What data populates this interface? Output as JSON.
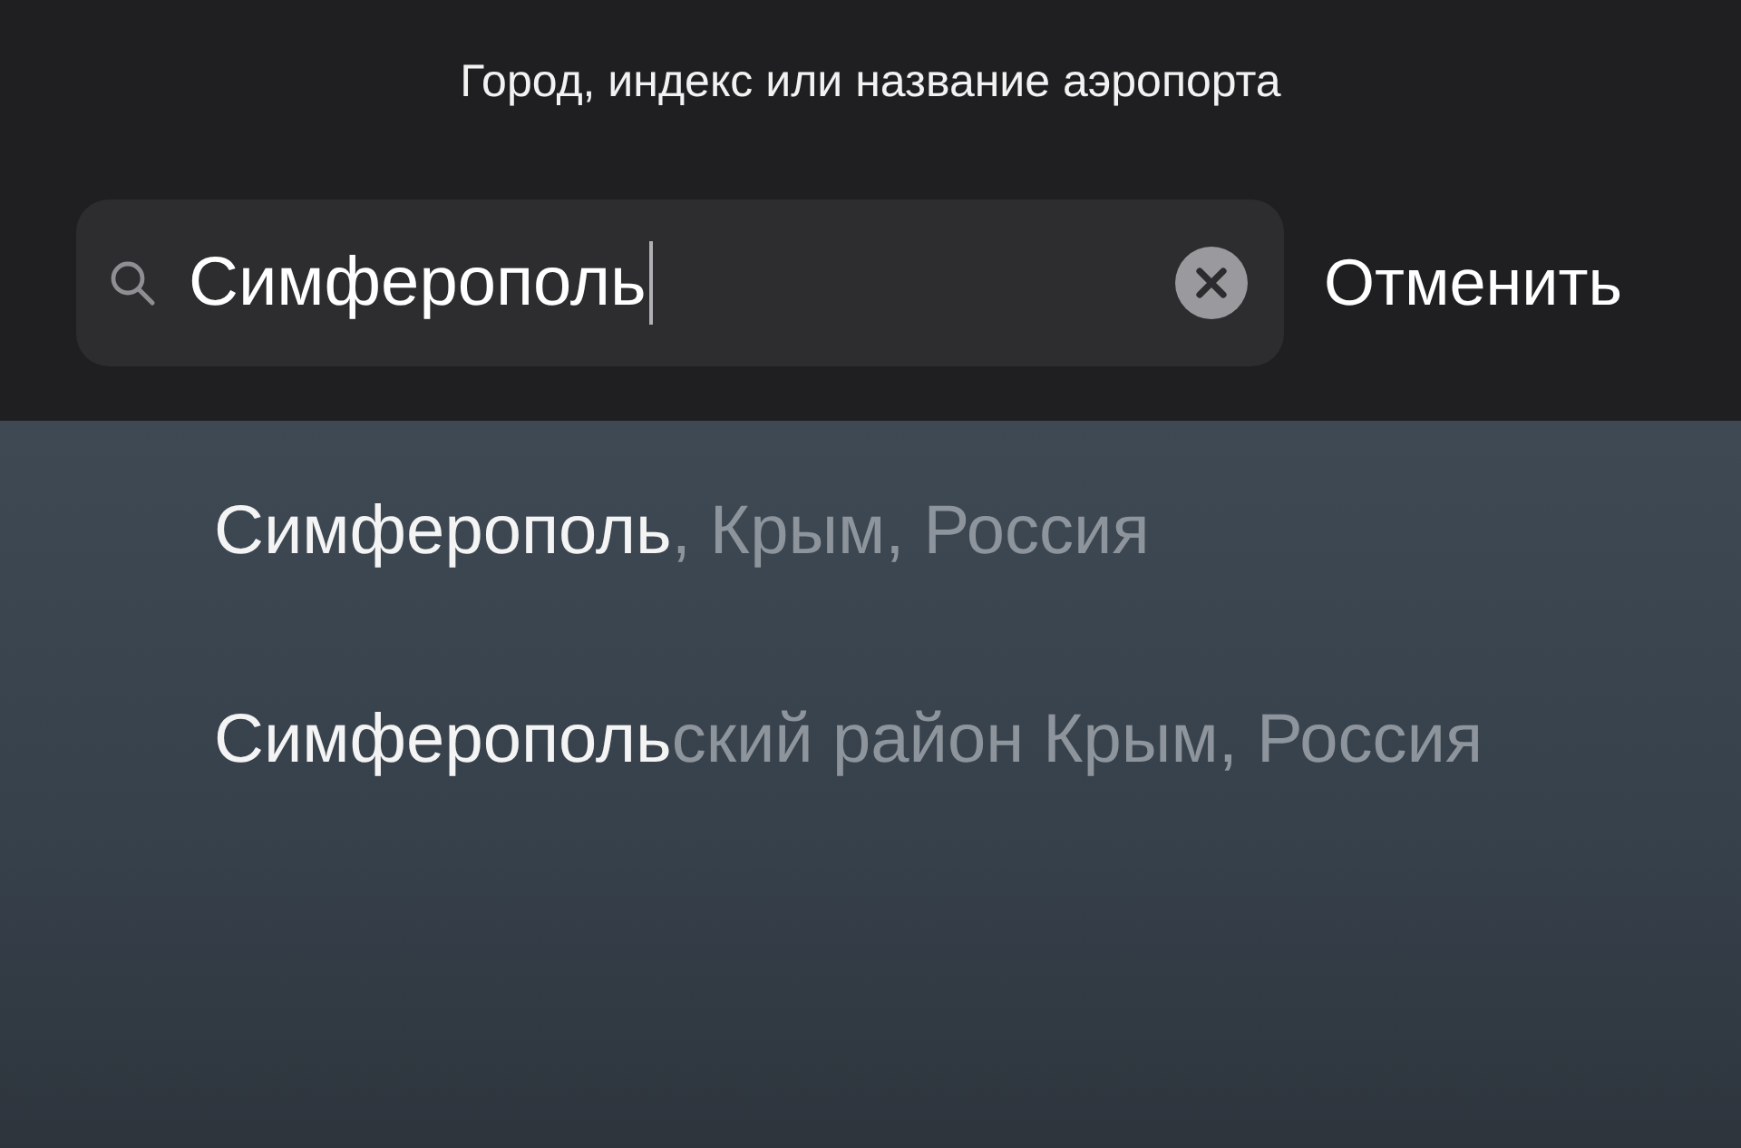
{
  "header": {
    "title": "Город, индекс или название аэропорта"
  },
  "search": {
    "value": "Симферополь",
    "cancel": "Отменить"
  },
  "results": [
    {
      "match": "Симферополь",
      "rest": ", Крым, Россия"
    },
    {
      "match": "Симферополь",
      "rest": "ский район Крым, Россия"
    }
  ]
}
